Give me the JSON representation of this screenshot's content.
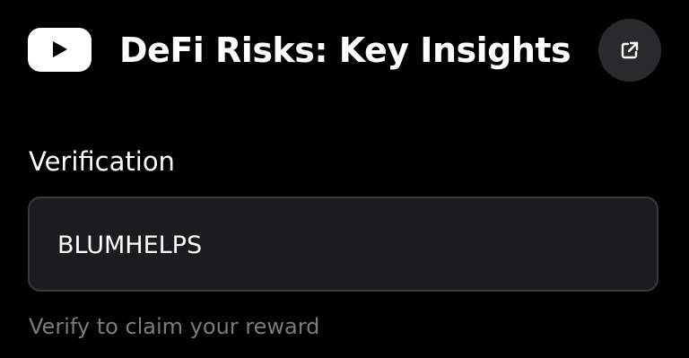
{
  "header": {
    "title": "DeFi Risks: Key Insights",
    "logo_icon": "youtube-play-icon",
    "external_link_icon": "external-link-icon"
  },
  "verification": {
    "label": "Verification",
    "value": "BLUMHELPS",
    "helper": "Verify to claim your reward"
  },
  "colors": {
    "background": "#000000",
    "input_background": "#1c1c1e",
    "input_border": "#3a3a3c",
    "button_background": "#2a2a2c",
    "helper_text": "#7c7c80",
    "text": "#ffffff"
  }
}
